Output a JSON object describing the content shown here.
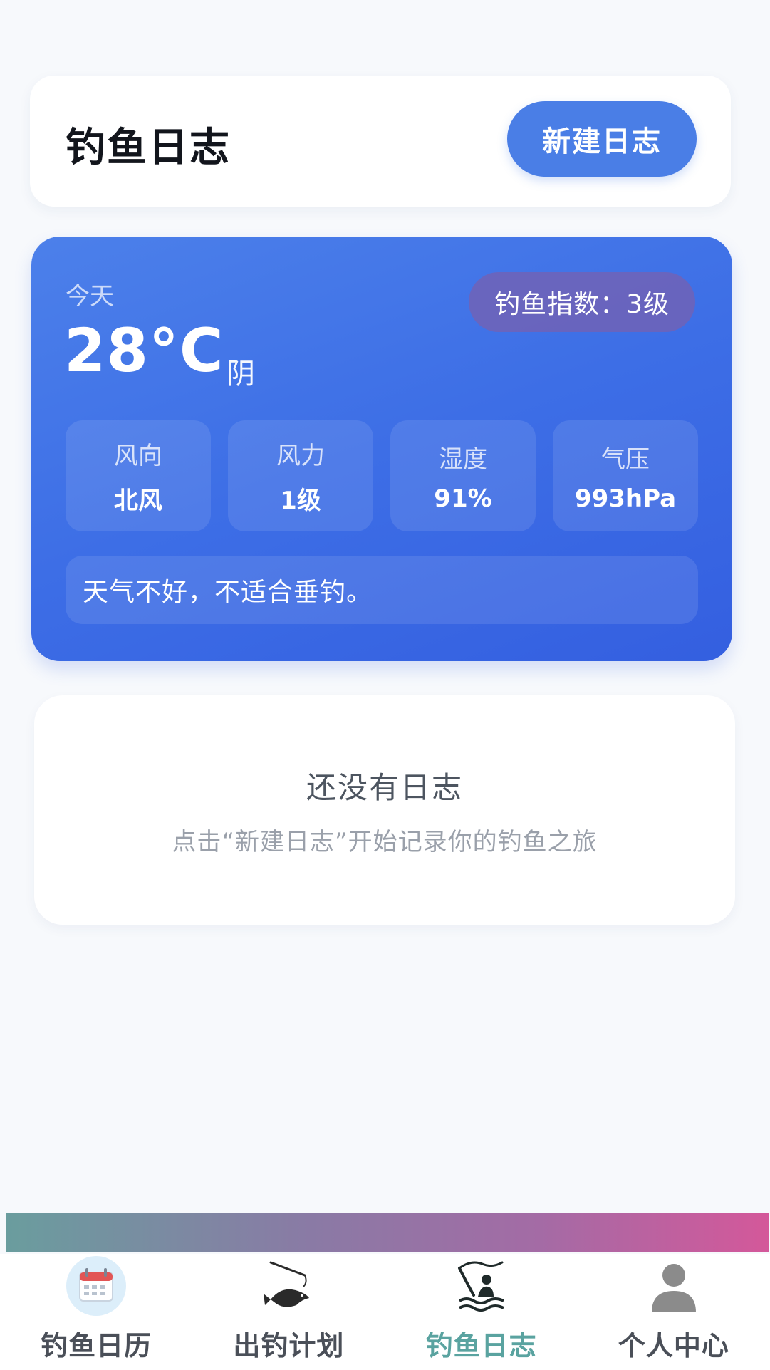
{
  "header": {
    "title": "钓鱼日志",
    "new_button_label": "新建日志"
  },
  "weather": {
    "day_label": "今天",
    "temperature": "28°C",
    "condition": "阴",
    "fishing_index": "钓鱼指数：3级",
    "stats": [
      {
        "label": "风向",
        "value": "北风"
      },
      {
        "label": "风力",
        "value": "1级"
      },
      {
        "label": "湿度",
        "value": "91%"
      },
      {
        "label": "气压",
        "value": "993hPa"
      }
    ],
    "advice": "天气不好，不适合垂钓。"
  },
  "empty_state": {
    "title": "还没有日志",
    "subtitle": "点击“新建日志”开始记录你的钓鱼之旅"
  },
  "tabs": [
    {
      "label": "钓鱼日历",
      "icon": "calendar-icon",
      "active": false
    },
    {
      "label": "出钓计划",
      "icon": "fishing-rod-icon",
      "active": false
    },
    {
      "label": "钓鱼日志",
      "icon": "angler-icon",
      "active": true
    },
    {
      "label": "个人中心",
      "icon": "user-icon",
      "active": false
    }
  ],
  "colors": {
    "primary": "#4a7ee6",
    "active_tab": "#5aa3a0"
  }
}
